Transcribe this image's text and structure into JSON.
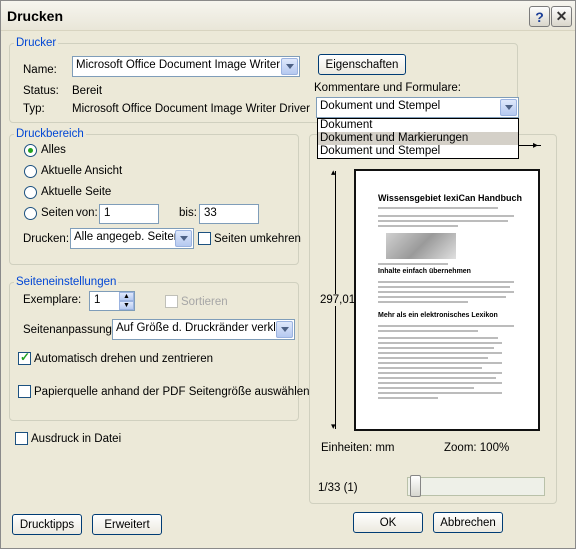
{
  "window": {
    "title": "Drucken"
  },
  "printer": {
    "legend": "Drucker",
    "name_label": "Name:",
    "name_value": "Microsoft Office Document Image Writer",
    "status_label": "Status:",
    "status_value": "Bereit",
    "type_label": "Typ:",
    "type_value": "Microsoft Office Document Image Writer Driver",
    "properties_button": "Eigenschaften",
    "comments_label": "Kommentare und Formulare:",
    "comments_value": "Dokument und Stempel",
    "comments_options": [
      "Dokument",
      "Dokument und Markierungen",
      "Dokument und Stempel"
    ]
  },
  "range": {
    "legend": "Druckbereich",
    "all": "Alles",
    "current_view": "Aktuelle Ansicht",
    "current_page": "Aktuelle Seite",
    "pages": "Seiten",
    "from_label": "von:",
    "from_value": "1",
    "to_label": "bis:",
    "to_value": "33",
    "print_label": "Drucken:",
    "print_value": "Alle angegeb. Seiten",
    "reverse_label": "Seiten umkehren"
  },
  "page_setup": {
    "legend": "Seiteneinstellungen",
    "copies_label": "Exemplare:",
    "copies_value": "1",
    "collate_label": "Sortieren",
    "scaling_label": "Seitenanpassung:",
    "scaling_value": "Auf Größe d. Druckränder verkl.",
    "autorotate_label": "Automatisch drehen und zentrieren",
    "papersource_label": "Papierquelle anhand der PDF Seitengröße auswählen"
  },
  "print_to_file_label": "Ausdruck in Datei",
  "preview": {
    "height_label": "297,01",
    "units": "Einheiten: mm",
    "zoom": "Zoom: 100%",
    "page_counter": "1/33 (1)",
    "slider_position": 0,
    "doc_title": "Wissensgebiet lexiCan Handbuch",
    "doc_heading1": "Inhalte einfach übernehmen",
    "doc_heading2": "Mehr als ein elektronisches Lexikon"
  },
  "buttons": {
    "tips": "Drucktipps",
    "advanced": "Erweitert",
    "ok": "OK",
    "cancel": "Abbrechen"
  }
}
